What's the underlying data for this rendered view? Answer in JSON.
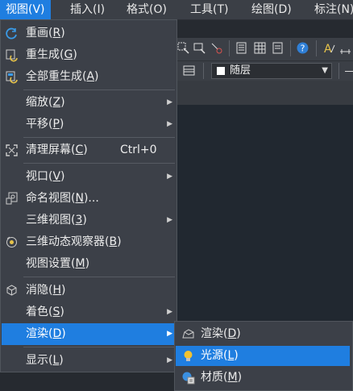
{
  "menubar": {
    "items": [
      {
        "label": "视图(V)"
      },
      {
        "label": "插入(I)"
      },
      {
        "label": "格式(O)"
      },
      {
        "label": "工具(T)"
      },
      {
        "label": "绘图(D)"
      },
      {
        "label": "标注(N)"
      }
    ]
  },
  "toolbar": {
    "layer_value": "随层"
  },
  "view_menu": {
    "items": [
      {
        "label": "重画",
        "key": "R"
      },
      {
        "label": "重生成",
        "key": "G"
      },
      {
        "label": "全部重生成",
        "key": "A"
      },
      {
        "label": "缩放",
        "key": "Z"
      },
      {
        "label": "平移",
        "key": "P"
      },
      {
        "label": "清理屏幕",
        "key": "C",
        "shortcut": "Ctrl+0"
      },
      {
        "label": "视口",
        "key": "V"
      },
      {
        "label": "命名视图",
        "key": "N",
        "suffix": "..."
      },
      {
        "label": "三维视图",
        "key": "3"
      },
      {
        "label": "三维动态观察器",
        "key": "B"
      },
      {
        "label": "视图设置",
        "key": "M"
      },
      {
        "label": "消隐",
        "key": "H"
      },
      {
        "label": "着色",
        "key": "S"
      },
      {
        "label": "渲染",
        "key": "D"
      },
      {
        "label": "显示",
        "key": "L"
      }
    ]
  },
  "render_submenu": {
    "items": [
      {
        "label": "渲染",
        "key": "D"
      },
      {
        "label": "光源",
        "key": "L"
      },
      {
        "label": "材质",
        "key": "M"
      }
    ]
  },
  "colors": {
    "accent": "#1f7ee0",
    "menu_bg": "#3c4048",
    "workspace": "#212830"
  },
  "icons": [
    "redraw-icon",
    "regen-icon",
    "regen-all-icon",
    "clean-screen-icon",
    "named-view-icon",
    "orbit-icon",
    "hide-icon",
    "render-icon",
    "light-bulb-icon",
    "material-icon",
    "submenu-arrow-icon"
  ]
}
